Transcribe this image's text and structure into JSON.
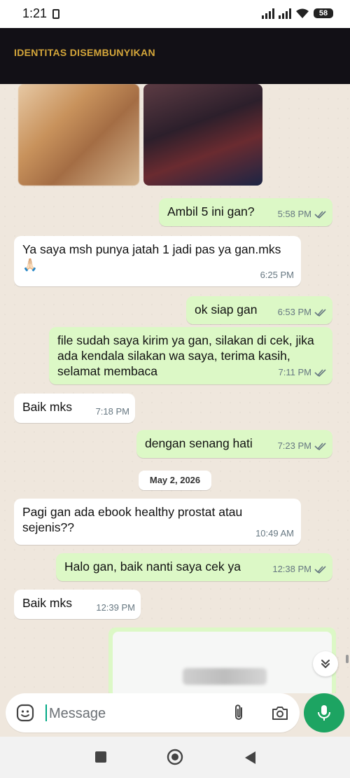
{
  "status_bar": {
    "time": "1:21",
    "battery": "58"
  },
  "header": {
    "title": "IDENTITAS DISEMBUNYIKAN"
  },
  "messages": [
    {
      "dir": "out",
      "text": "Ambil 5 ini gan?",
      "time": "5:58 PM"
    },
    {
      "dir": "in",
      "text": "Ya saya msh punya jatah 1 jadi pas ya gan.mks 🙏🏻",
      "time": "6:25 PM"
    },
    {
      "dir": "out",
      "text": "ok siap gan",
      "time": "6:53 PM"
    },
    {
      "dir": "out",
      "text": "file sudah saya kirim ya gan, silakan di cek, jika ada kendala silakan wa saya, terima kasih, selamat membaca",
      "time": "7:11 PM"
    },
    {
      "dir": "in",
      "text": "Baik mks",
      "time": "7:18 PM"
    },
    {
      "dir": "out",
      "text": "dengan senang hati",
      "time": "7:23 PM"
    },
    {
      "dir": "in",
      "text": "Pagi gan ada ebook healthy prostat atau sejenis??",
      "time": "10:49 AM"
    },
    {
      "dir": "out",
      "text": "Halo gan, baik nanti saya cek ya",
      "time": "12:38 PM"
    },
    {
      "dir": "in",
      "text": "Baik mks",
      "time": "12:39 PM"
    }
  ],
  "date_divider": "May 2, 2026",
  "input": {
    "placeholder": "Message"
  },
  "colors": {
    "header_bg": "#121016",
    "header_title": "#d4a63a",
    "outgoing": "#dcf8c6",
    "incoming": "#ffffff",
    "accent": "#1da462"
  },
  "icons": [
    "sticker-icon",
    "attach-icon",
    "camera-icon",
    "mic-icon",
    "double-check-icon",
    "chevrons-down-icon"
  ]
}
